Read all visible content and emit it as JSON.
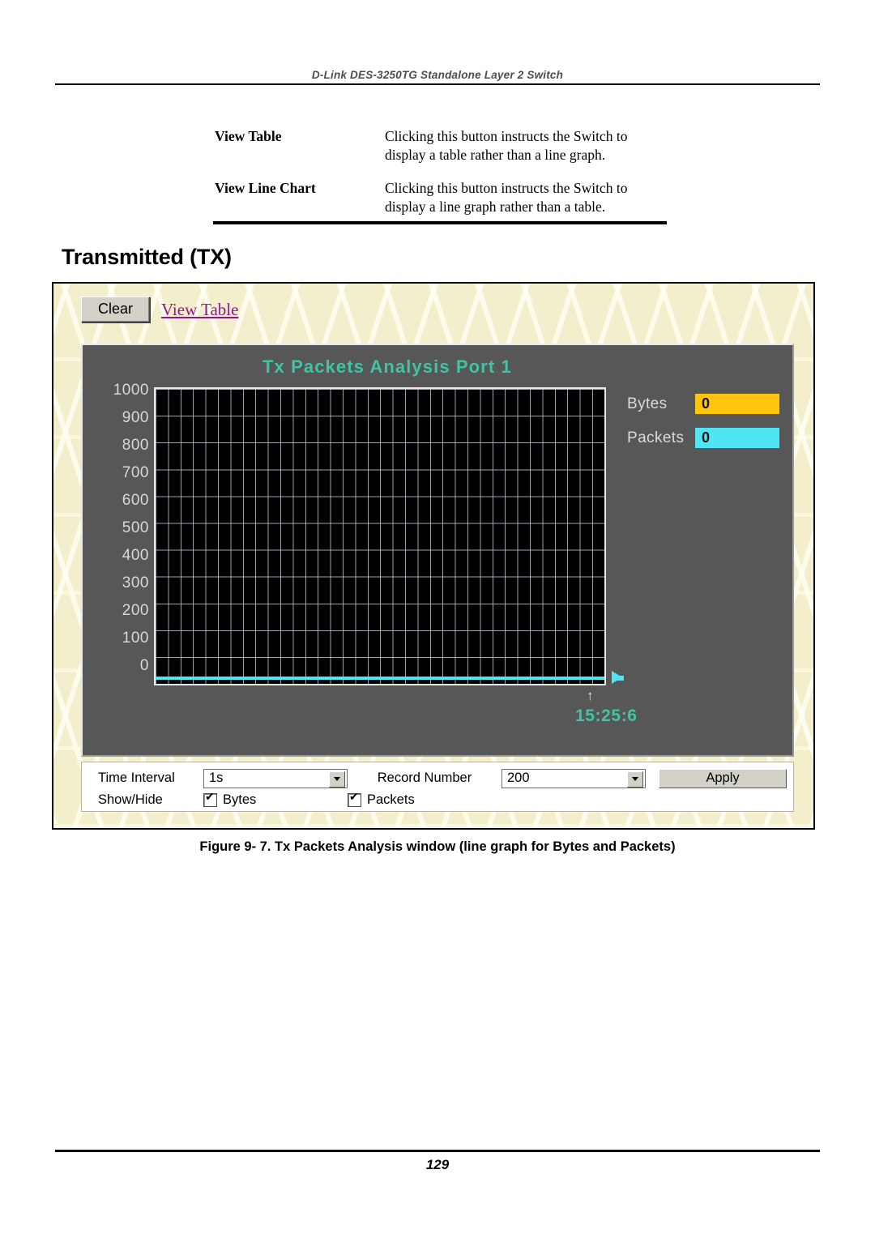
{
  "page": {
    "running_header": "D-Link DES-3250TG Standalone Layer 2 Switch",
    "page_number": "129",
    "section_title": "Transmitted (TX)",
    "figure_caption": "Figure 9- 7.  Tx Packets Analysis window (line graph for Bytes and Packets)"
  },
  "definitions": [
    {
      "term": "View Table",
      "description": "Clicking this button instructs the Switch to display a table rather than a line graph."
    },
    {
      "term": "View Line Chart",
      "description": "Clicking this button instructs the Switch to display a line graph rather than a table."
    }
  ],
  "applet": {
    "toolbar": {
      "clear_label": "Clear",
      "view_table_link": "View Table"
    },
    "legend": [
      {
        "label": "Bytes",
        "value": "0",
        "color": "#FFC40C"
      },
      {
        "label": "Packets",
        "value": "0",
        "color": "#4EE6F2"
      }
    ],
    "timestamp": "15:25:6",
    "controls": {
      "time_interval_label": "Time Interval",
      "time_interval_value": "1s",
      "record_number_label": "Record Number",
      "record_number_value": "200",
      "apply_label": "Apply",
      "show_hide_label": "Show/Hide",
      "show_bytes_label": "Bytes",
      "show_packets_label": "Packets"
    }
  },
  "chart_data": {
    "type": "line",
    "title": "Tx Packets Analysis  Port 1",
    "xlabel": "",
    "ylabel": "",
    "ylim": [
      0,
      1000
    ],
    "y_ticks": [
      1000,
      900,
      800,
      700,
      600,
      500,
      400,
      300,
      200,
      100,
      0
    ],
    "grid": true,
    "legend_position": "right",
    "x_tick_labels": [
      "15:25:6"
    ],
    "series": [
      {
        "name": "Bytes",
        "color": "#FFC40C",
        "current_value": 0,
        "values": [
          0
        ]
      },
      {
        "name": "Packets",
        "color": "#4EE6F2",
        "current_value": 0,
        "values": [
          0
        ]
      }
    ],
    "notes": "All plotted values are 0; only the zero baseline is visible at the bottom of the plot."
  }
}
